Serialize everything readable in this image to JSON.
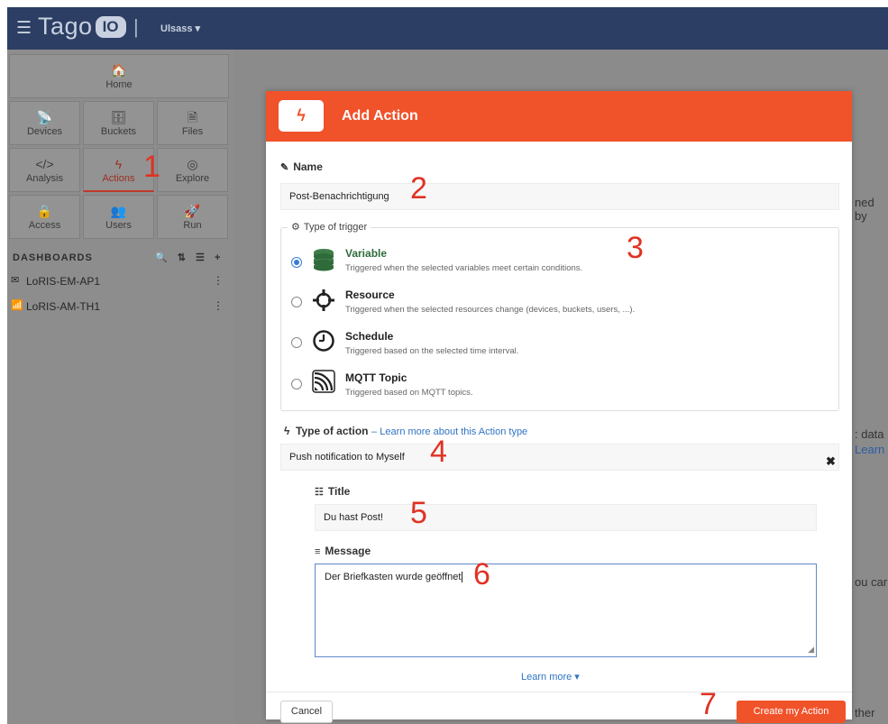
{
  "topbar": {
    "logo_text": "Tago",
    "logo_badge": "IO",
    "separator": "|",
    "account": "Ulsass ▾"
  },
  "sidebar": {
    "tiles": [
      {
        "label": "Home",
        "icon": "🏠"
      },
      {
        "label": "Devices",
        "icon": "📡"
      },
      {
        "label": "Buckets",
        "icon": "🗄"
      },
      {
        "label": "Files",
        "icon": "🗎"
      },
      {
        "label": "Analysis",
        "icon": "</>"
      },
      {
        "label": "Actions",
        "icon": "ϟ"
      },
      {
        "label": "Explore",
        "icon": "◎"
      },
      {
        "label": "Access",
        "icon": "🔒"
      },
      {
        "label": "Users",
        "icon": "👥"
      },
      {
        "label": "Run",
        "icon": "🚀"
      }
    ],
    "dashboards_title": "DASHBOARDS",
    "dashboards_tools": "🔍 ⇅ ☰ +",
    "dashboards": [
      {
        "label": "LoRIS-EM-AP1",
        "icon": "✉"
      },
      {
        "label": "LoRIS-AM-TH1",
        "icon": "📶"
      }
    ]
  },
  "background": {
    "t1": "ned by",
    "t2": ": data",
    "t3": "Learn",
    "t4": "ou car",
    "t5": "ther ex"
  },
  "annotations": [
    "1",
    "2",
    "3",
    "4",
    "5",
    "6",
    "7"
  ],
  "modal": {
    "title": "Add Action",
    "header_icon": "ϟ",
    "name_label": "Name",
    "name_value": "Post-Benachrichtigung",
    "trigger_legend": "Type of trigger",
    "triggers": [
      {
        "title": "Variable",
        "desc": "Triggered when the selected variables meet certain conditions.",
        "icon": "database-icon"
      },
      {
        "title": "Resource",
        "desc": "Triggered when the selected resources change (devices, buckets, users, ...).",
        "icon": "crosshair-icon"
      },
      {
        "title": "Schedule",
        "desc": "Triggered based on the selected time interval.",
        "icon": "clock-icon"
      },
      {
        "title": "MQTT Topic",
        "desc": "Triggered based on MQTT topics.",
        "icon": "mqtt-icon"
      }
    ],
    "action_label": "Type of action",
    "action_dash": "–",
    "action_link": "Learn more about this Action type",
    "action_value": "Push notification to Myself",
    "title_label": "Title",
    "title_value": "Du hast Post!",
    "message_label": "Message",
    "message_value": "Der Briefkasten wurde geöffnet",
    "learn_more": "Learn more ▾",
    "cancel": "Cancel",
    "create": "Create my Action"
  }
}
